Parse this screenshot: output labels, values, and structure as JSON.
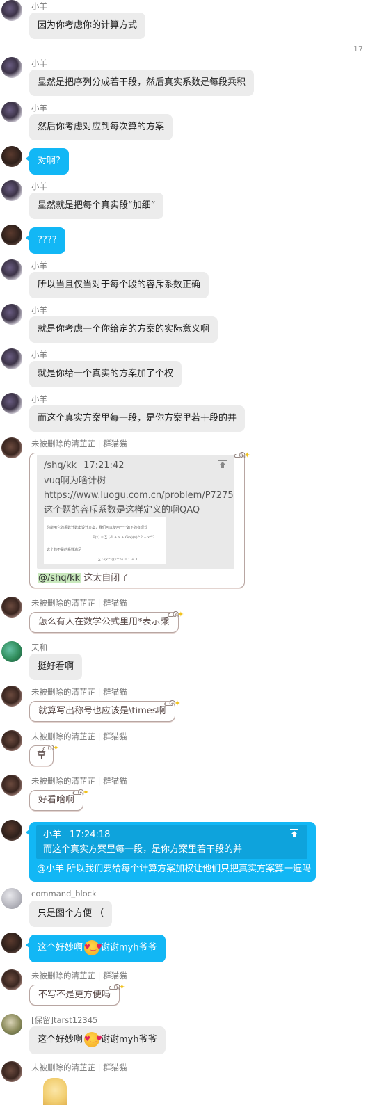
{
  "senders": {
    "xiaoyang": "小羊",
    "qingzhi": "未被删除的清芷芷 | 群猫猫",
    "tianhe": "天和",
    "command_block": "command_block",
    "tarst": "[保留]tarst12345"
  },
  "timestamp_17": "17",
  "messages": {
    "m1": "因为你考虑你的计算方式",
    "m2": "显然是把序列分成若干段，然后真实系数是每段乘积",
    "m3": "然后你考虑对应到每次算的方案",
    "m4": "对啊?",
    "m5": "显然就是把每个真实段“加细”",
    "m6": "????",
    "m7": "所以当且仅当对于每个段的容斥系数正确",
    "m8": "就是你考虑一个你给定的方案的实际意义啊",
    "m9": "就是你给一个真实的方案加了个权",
    "m10": "而这个真实方案里每一段，是你方案里若干段的并",
    "m12": "怎么有人在数学公式里用*表示乘",
    "m13": "挺好看啊",
    "m14": "就算写出称号也应该是\\times啊",
    "m15": "草",
    "m16": "好看啥啊",
    "m18": "只是图个方便 （",
    "m19_pre": "这个好妙啊",
    "m19_post": "谢谢myh爷爷",
    "m20": "不写不是更方便吗",
    "m21_pre": "这个好妙啊",
    "m21_post": "谢谢myh爷爷"
  },
  "quote1": {
    "author": "/shq/kk",
    "time": "17:21:42",
    "line1": "vuq啊为啥计树",
    "line2": "https://www.luogu.com.cn/problem/P7275",
    "line3": "这个题的容斥系数是这样定义的啊QAQ",
    "img_line1": "你能用它的系数计数出设计方案，我们可以使用一个如下的有理式",
    "img_formula1": "F(x) = ∑ (-1 + x + G(x)(x)^2 + x^2",
    "img_line2": "这个的不是的系数满足",
    "img_formula2": "∑ G(x^i)(x^n) = 1 + 1",
    "mention": "@/shq/kk",
    "reply": " 这太自闭了"
  },
  "quote2": {
    "author": "小羊",
    "time": "17:24:18",
    "line": "而这个真实方案里每一段，是你方案里若干段的并",
    "reply": "@小羊 所以我们要给每个计算方案加权让他们只把真实方案算一遍吗"
  },
  "icons": {
    "avatar": "avatar-icon",
    "pin": "pin-top-icon",
    "emoji": "heart-eyes-emoji-icon",
    "bubble_deco": "cat-ear-deco-icon"
  },
  "colors": {
    "blue_bubble": "#12b7f5",
    "gray_bubble": "#ececec",
    "mention_bg": "#c9e9bd"
  }
}
